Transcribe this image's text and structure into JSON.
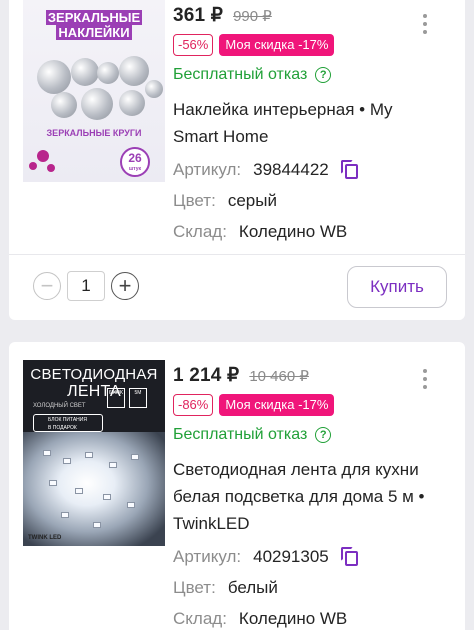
{
  "products": [
    {
      "price": "361 ₽",
      "old_price": "990 ₽",
      "discount_badge": "-56%",
      "sale_badge": "Моя скидка -17%",
      "free_return": "Бесплатный отказ",
      "help_icon": "?",
      "title": "Наклейка интерьерная • My Smart Home",
      "article_label": "Артикул:",
      "article_value": "39844422",
      "color_label": "Цвет:",
      "color_value": "серый",
      "warehouse_label": "Склад:",
      "warehouse_value": "Коледино WB",
      "quantity": "1",
      "buy_label": "Купить",
      "image_text": {
        "heading_line1": "ЗЕРКАЛЬНЫЕ",
        "heading_line2": "НАКЛЕЙКИ",
        "subheading": "ЗЕРКАЛЬНЫЕ КРУГИ",
        "count": "26",
        "count_unit": "штук"
      }
    },
    {
      "price": "1 214 ₽",
      "old_price": "10 460 ₽",
      "discount_badge": "-86%",
      "sale_badge": "Моя скидка -17%",
      "free_return": "Бесплатный отказ",
      "help_icon": "?",
      "title": "Светодиодная лента для кухни белая подсветка для дома 5 м • TwinkLED",
      "article_label": "Артикул:",
      "article_value": "40291305",
      "color_label": "Цвет:",
      "color_value": "белый",
      "warehouse_label": "Склад:",
      "warehouse_value": "Коледино WB",
      "image_text": {
        "heading_line1": "СВЕТОДИОДНАЯ",
        "heading_line2": "ЛЕНТА",
        "subheading": "ХОЛОДНЫЙ СВЕТ",
        "spec1": "6500K",
        "spec2": "5М",
        "gift_line1": "БЛОК ПИТАНИЯ",
        "gift_line2": "В ПОДАРОК",
        "brand": "TWINK LED"
      }
    }
  ],
  "icons": {
    "minus": "−",
    "plus": "+"
  },
  "colors": {
    "accent": "#7c2fc1",
    "sale": "#f0157a",
    "discount": "#e0245e",
    "free_return": "#21a038"
  }
}
